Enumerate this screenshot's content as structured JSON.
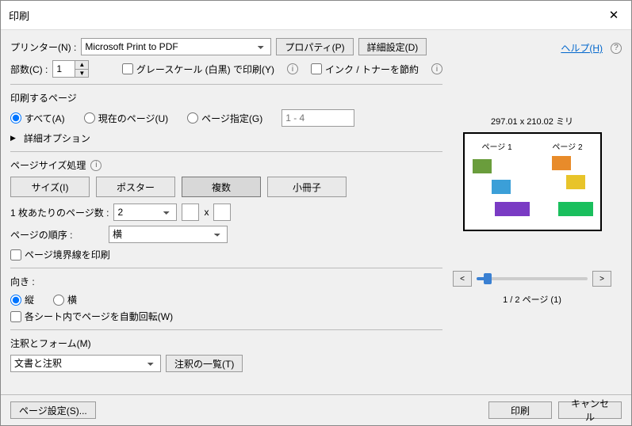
{
  "title": "印刷",
  "printer": {
    "label": "プリンター(N) :",
    "selected": "Microsoft Print to PDF",
    "properties_btn": "プロパティ(P)",
    "advanced_btn": "詳細設定(D)",
    "help_link": "ヘルプ(H)"
  },
  "copies": {
    "label": "部数(C) :",
    "value": "1"
  },
  "options": {
    "grayscale": "グレースケール (白黒) で印刷(Y)",
    "save_toner": "インク / トナーを節約"
  },
  "pages": {
    "title": "印刷するページ",
    "all": "すべて(A)",
    "current": "現在のページ(U)",
    "range": "ページ指定(G)",
    "range_placeholder": "1 - 4",
    "advanced": "詳細オプション"
  },
  "sizing": {
    "title": "ページサイズ処理",
    "tabs": {
      "size": "サイズ(I)",
      "poster": "ポスター",
      "multiple": "複数",
      "booklet": "小冊子"
    },
    "pages_per_sheet_label": "1 枚あたりのページ数 :",
    "pages_per_sheet_value": "2",
    "x": "x",
    "order_label": "ページの順序 :",
    "order_value": "横",
    "border_label": "ページ境界線を印刷"
  },
  "orientation": {
    "title": "向き :",
    "portrait": "縦",
    "landscape": "横",
    "auto_rotate": "各シート内でページを自動回転(W)"
  },
  "comments": {
    "title": "注釈とフォーム(M)",
    "value": "文書と注釈",
    "summary_btn": "注釈の一覧(T)"
  },
  "preview": {
    "dimensions": "297.01 x 210.02 ミリ",
    "page1": "ページ 1",
    "page2": "ページ 2",
    "counter": "1 / 2 ページ  (1)"
  },
  "footer": {
    "page_setup": "ページ設定(S)...",
    "print": "印刷",
    "cancel": "キャンセル"
  }
}
